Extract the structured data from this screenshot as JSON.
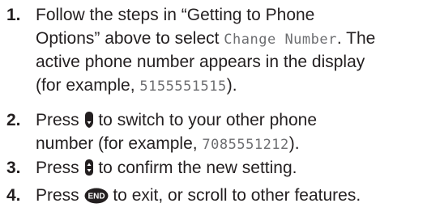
{
  "steps": [
    {
      "number": "1.",
      "line1_a": "Follow the steps in “Getting to Phone",
      "line2_a": "Options” above to select ",
      "line2_lcd": "Change Number",
      "line2_b": ". The",
      "line3": "active phone number appears in the display",
      "line4_a": "(for example, ",
      "line4_lcd": "5155551515",
      "line4_b": ")."
    },
    {
      "number": "2.",
      "line1_a": "Press ",
      "line1_icon": "scroll-down-key-icon",
      "line1_b": " to switch to your other phone",
      "line2_a": "number (for example, ",
      "line2_lcd": "7085551212",
      "line2_b": ")."
    },
    {
      "number": "3.",
      "line1_a": "Press ",
      "line1_icon": "select-ok-key-icon",
      "line1_b": " to confirm the new setting."
    },
    {
      "number": "4.",
      "line1_a": "Press ",
      "line1_icon": "end-key-icon",
      "end_key_label": "END",
      "line1_b": " to exit, or scroll to other features."
    }
  ],
  "colors": {
    "text": "#231f20",
    "lcd_text": "#6d6e71",
    "key_fill": "#231f20"
  }
}
